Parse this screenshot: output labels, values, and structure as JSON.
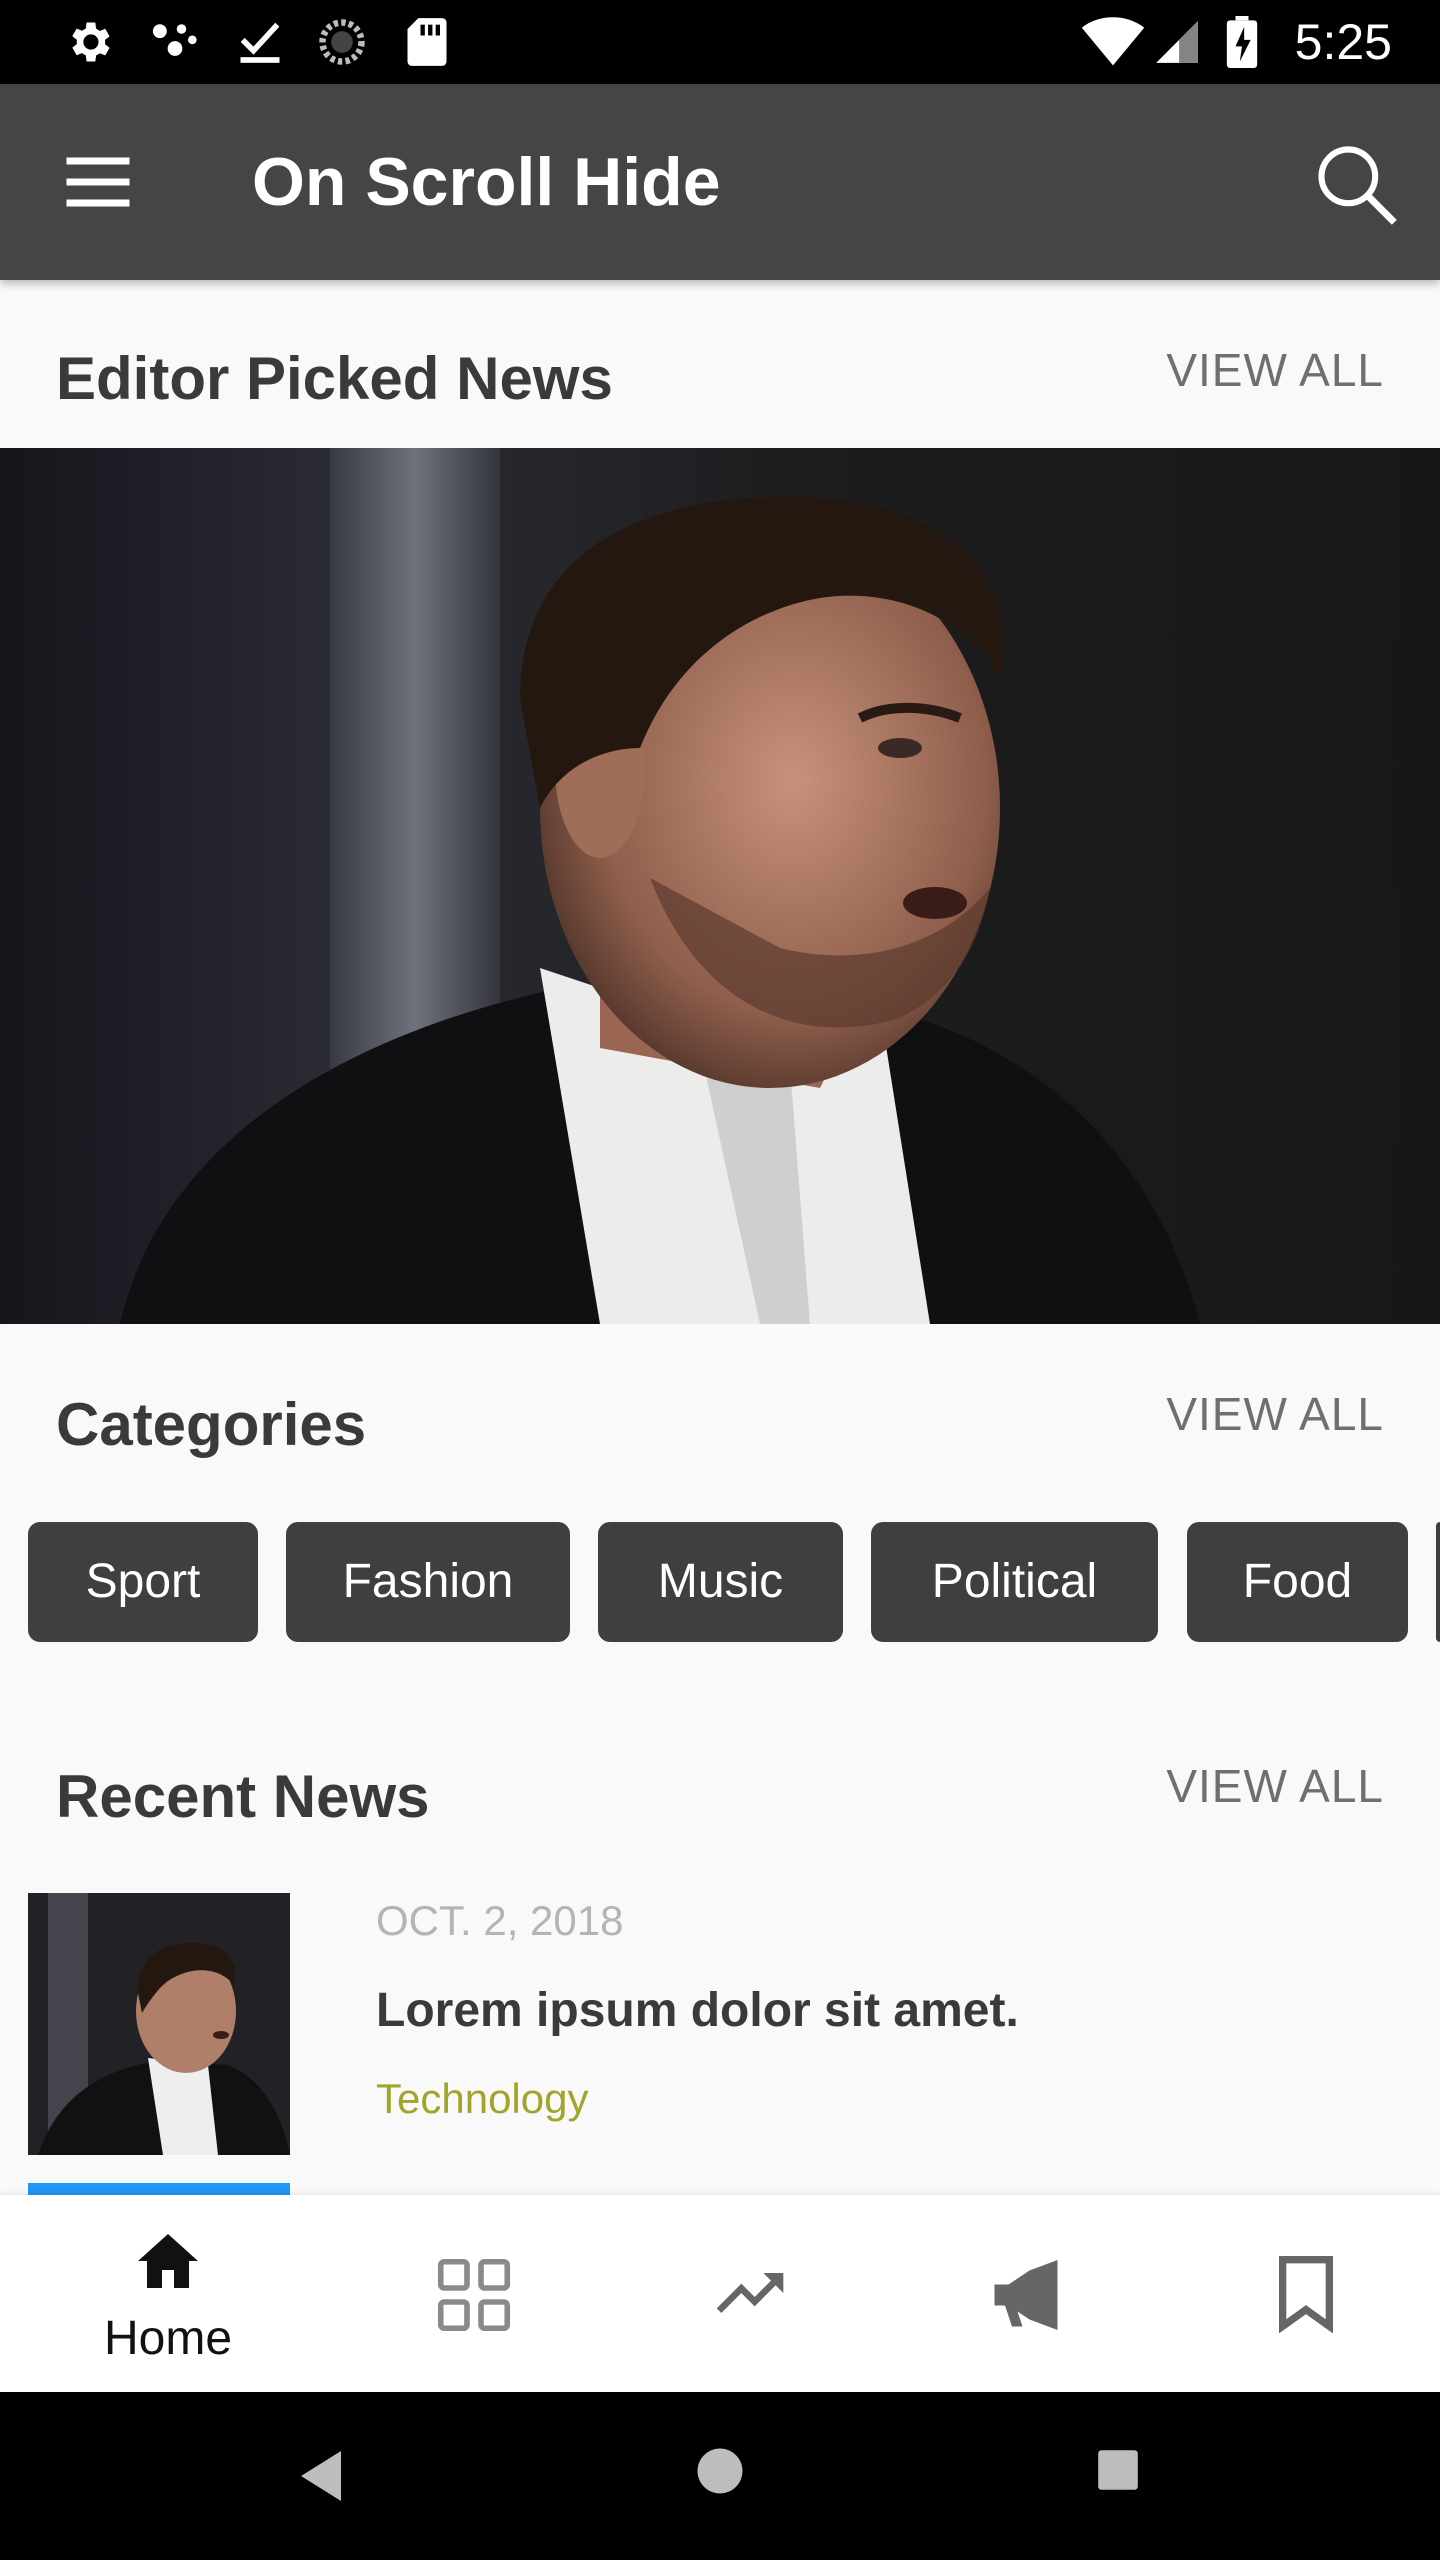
{
  "status_bar": {
    "time": "5:25",
    "left_icons": [
      "settings-icon",
      "dots-icon",
      "download-done-icon",
      "sync-icon",
      "sd-card-icon"
    ],
    "right_icons": [
      "wifi-icon",
      "signal-icon",
      "battery-charging-icon"
    ]
  },
  "app_bar": {
    "title": "On Scroll Hide",
    "menu_icon": "menu-icon",
    "search_icon": "search-icon"
  },
  "editor_picked": {
    "title": "Editor Picked News",
    "view_all": "VIEW ALL"
  },
  "categories": {
    "title": "Categories",
    "view_all": "VIEW ALL",
    "items": [
      "Sport",
      "Fashion",
      "Music",
      "Political",
      "Food"
    ]
  },
  "recent_news": {
    "title": "Recent News",
    "view_all": "VIEW ALL",
    "items": [
      {
        "date": "OCT. 2, 2018",
        "headline": "Lorem ipsum dolor sit amet.",
        "category": "Technology"
      }
    ]
  },
  "bottom_nav": {
    "items": [
      {
        "label": "Home",
        "icon": "home-icon",
        "active": true
      },
      {
        "label": "",
        "icon": "grid-icon",
        "active": false
      },
      {
        "label": "",
        "icon": "trending-icon",
        "active": false
      },
      {
        "label": "",
        "icon": "megaphone-icon",
        "active": false
      },
      {
        "label": "",
        "icon": "bookmark-icon",
        "active": false
      }
    ]
  },
  "colors": {
    "app_bar": "#454545",
    "chip": "#3f3f3f",
    "category_text": "#a2a52a",
    "accent_strip": "#2196f3"
  }
}
